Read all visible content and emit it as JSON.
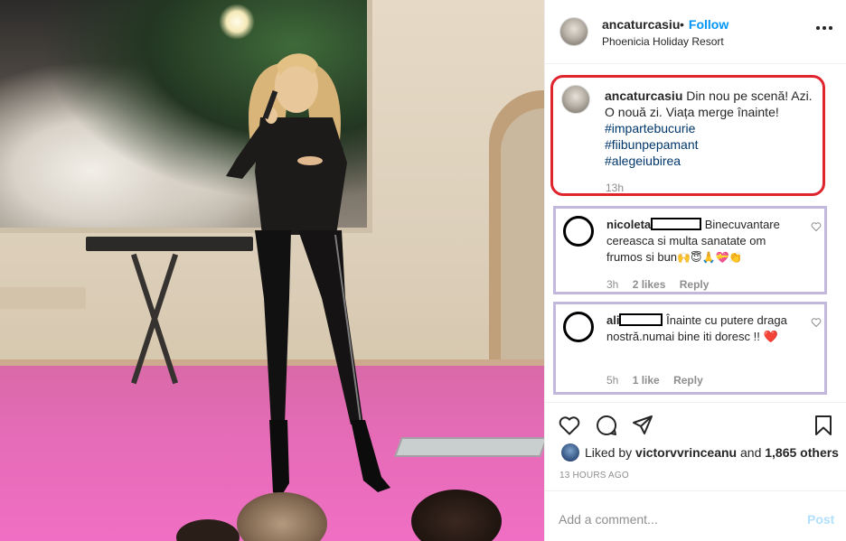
{
  "post": {
    "username": "ancaturcasiu",
    "follow_label": "Follow",
    "dot": "•",
    "location": "Phoenicia Holiday Resort",
    "more_icon": "more-horizontal-icon"
  },
  "caption": {
    "username": "ancaturcasiu",
    "text": "Din nou pe scenă! Azi. O nouă zi. Viața merge înainte!",
    "hashtags": [
      "#impartebucurie",
      "#fiibunpepamant",
      "#alegeiubirea"
    ],
    "time": "13h"
  },
  "comments": [
    {
      "user_prefix": "nicoleta",
      "text": "Binecuvantare cereasca si multa sanatate om frumos si bun",
      "emojis": "🙌😇🙏💝👏",
      "time": "3h",
      "likes": "2 likes",
      "reply": "Reply"
    },
    {
      "user_prefix": "ali",
      "text": "Înainte cu putere draga nostră.numai bine iti doresc !!",
      "emojis": "❤️",
      "time": "5h",
      "likes": "1 like",
      "reply": "Reply"
    }
  ],
  "likes": {
    "prefix": "Liked by",
    "user": "victorvvrinceanu",
    "and": "and",
    "others": "1,865 others"
  },
  "posted_ago": "13 HOURS AGO",
  "add_comment": {
    "placeholder": "Add a comment...",
    "post_label": "Post"
  },
  "colors": {
    "follow_blue": "#0095f6",
    "hashtag_blue": "#00376b",
    "caption_outline_red": "#e0242e",
    "comment_outline_lavender": "#c2b8dd",
    "post_disabled_blue": "#b2dffc",
    "stage_pink": "#f06fc4"
  }
}
